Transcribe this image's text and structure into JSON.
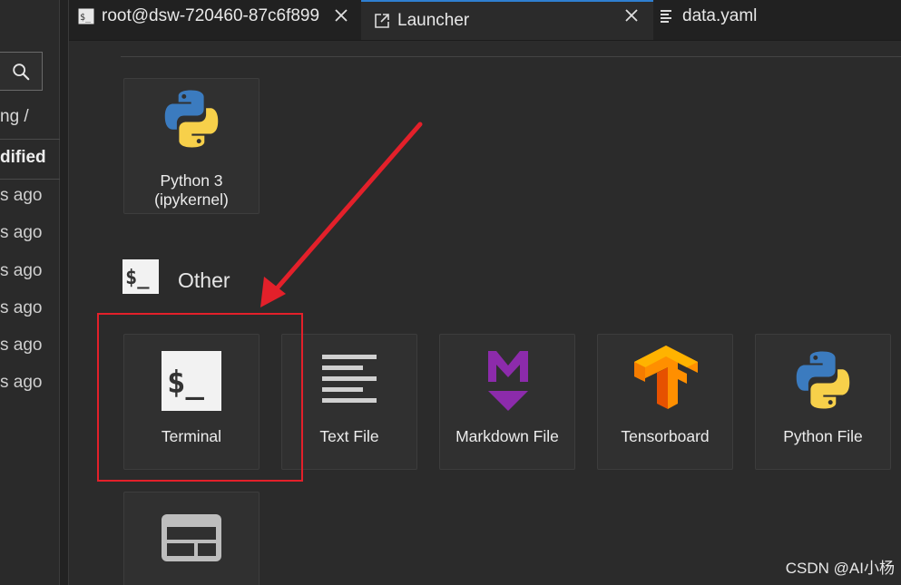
{
  "sidebar": {
    "breadcrumb": "ng /",
    "column_header": "dified",
    "rows": [
      "s ago",
      "s ago",
      "s ago",
      "s ago",
      "s ago",
      "s ago"
    ]
  },
  "tabs": {
    "terminal": {
      "label": "root@dsw-720460-87c6f899",
      "icon": "terminal-tab-icon"
    },
    "launcher": {
      "label": "Launcher",
      "icon": "launcher-tab-icon"
    },
    "data": {
      "label": "data.yaml",
      "icon": "text-file-tab-icon"
    }
  },
  "launcher": {
    "notebook_card": {
      "label_line1": "Python 3",
      "label_line2": "(ipykernel)",
      "icon": "python-icon"
    },
    "other_section": {
      "title": "Other",
      "icon": "terminal-section-icon"
    },
    "other_cards": [
      {
        "label": "Terminal",
        "icon": "terminal-icon"
      },
      {
        "label": "Text File",
        "icon": "text-file-icon"
      },
      {
        "label": "Markdown File",
        "icon": "markdown-icon"
      },
      {
        "label": "Tensorboard",
        "icon": "tensorboard-icon"
      },
      {
        "label": "Python File",
        "icon": "python-icon"
      }
    ],
    "extra_card": {
      "label": "",
      "icon": "show-contextual-help-icon"
    }
  },
  "annotation": {
    "color": "#e3202a"
  },
  "watermark": "CSDN @AI小杨",
  "colors": {
    "accent": "#2f7fd1",
    "background": "#2b2b2b"
  }
}
